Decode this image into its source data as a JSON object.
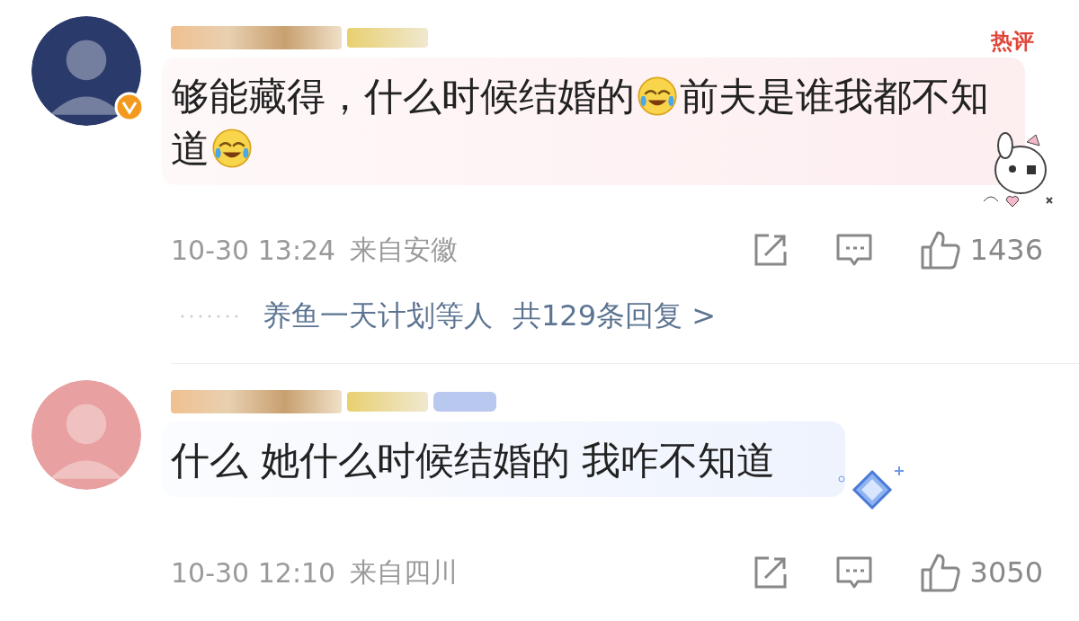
{
  "comments": [
    {
      "hot_badge": "热评",
      "verified": true,
      "content": [
        {
          "kind": "text",
          "text": "够能藏得，什么时候结婚的"
        },
        {
          "kind": "emoji"
        },
        {
          "kind": "text",
          "text": "前夫是谁我都不知"
        },
        {
          "kind": "text",
          "text": "道"
        },
        {
          "kind": "emoji"
        }
      ],
      "time": "10-30 13:24",
      "location": "来自安徽",
      "likes": "1436",
      "replies": {
        "names": "养鱼一天计划等人",
        "count": "共129条回复 >"
      }
    },
    {
      "verified": false,
      "content": [
        {
          "kind": "text",
          "text": "什么 她什么时候结婚的 我咋不知道"
        }
      ],
      "time": "10-30 12:10",
      "location": "来自四川",
      "likes": "3050"
    }
  ]
}
